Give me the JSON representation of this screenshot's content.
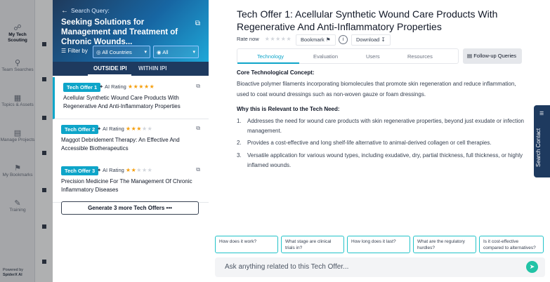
{
  "nav": {
    "items": [
      {
        "label": "My Tech Scouting",
        "icon": "scouting-icon"
      },
      {
        "label": "Team Searches",
        "icon": "team-icon"
      },
      {
        "label": "Topics & Assets",
        "icon": "topics-icon"
      },
      {
        "label": "Manage Projects",
        "icon": "projects-icon"
      },
      {
        "label": "My Bookmarks",
        "icon": "bookmark-icon"
      },
      {
        "label": "Training",
        "icon": "training-icon"
      }
    ],
    "powered_by": "Powered by",
    "brand": "SpiderX AI"
  },
  "search": {
    "back_label": "Search Query:",
    "query_text": "Seeking Solutions for Management and Treatment of Chronic Wounds...",
    "filter_label": "Filter by",
    "country_select": "All Countries",
    "visibility_select": "All",
    "tab_outside": "OUTSIDE IPI",
    "tab_within": "WITHIN IPI"
  },
  "offers": [
    {
      "badge": "Tech Offer 1",
      "rating_label": "AI Rating",
      "stars": 5,
      "title": "Acellular Synthetic Wound Care Products With Regenerative And Anti-Inflammatory Properties"
    },
    {
      "badge": "Tech Offer 2",
      "rating_label": "AI Rating",
      "stars": 3,
      "title": "Maggot Debridement Therapy: An Effective And Accessible Biotherapeutics"
    },
    {
      "badge": "Tech Offer 3",
      "rating_label": "AI Rating",
      "stars": 2,
      "title": "Precision Medicine For The Management Of Chronic Inflammatory Diseases"
    }
  ],
  "generate_button": "Generate 3 more Tech Offers •••",
  "detail": {
    "title": "Tech Offer 1: Acellular Synthetic Wound Care Products With Regenerative And Anti-Inflammatory Properties",
    "rate_now": "Rate now",
    "bookmark": "Bookmark",
    "download": "Download",
    "tabs": [
      "Technology",
      "Evaluation",
      "Users",
      "Resources"
    ],
    "followup": "Follow-up Queries",
    "concept_heading": "Core Technological Concept:",
    "concept_text": "Bioactive polymer filaments incorporating biomolecules that promote skin regeneration and reduce inflammation, used to coat wound dressings such as non-woven gauze or foam dressings.",
    "relevance_heading": "Why this is Relevant to the Tech Need:",
    "points": [
      "Addresses the need for wound care products with skin regenerative properties, beyond just exudate or infection management.",
      "Provides a cost-effective and long shelf-life alternative to animal-derived collagen or cell therapies.",
      "Versatile application for various wound types, including exudative, dry, partial thickness, full thickness, or highly inflamed wounds."
    ],
    "side_tab": "Search Contact"
  },
  "chips": [
    "How does it work?",
    "What stage are clinical trials in?",
    "How long does it last?",
    "What are the regulatory hurdles?",
    "Is it cost-effective compared to alternatives?"
  ],
  "ask_placeholder": "Ask anything related to this Tech Offer...",
  "colors": {
    "accent": "#0ea5c9",
    "nav_dark": "#1e3a5f",
    "star": "#f59e0b",
    "chip_border": "#22c3c9"
  }
}
